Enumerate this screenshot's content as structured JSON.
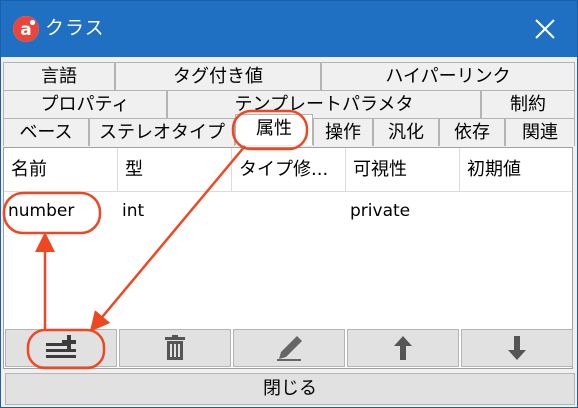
{
  "window": {
    "title": "クラス",
    "app_icon": "astah-logo-icon",
    "close_icon": "close-icon"
  },
  "tabs": {
    "row1": [
      "言語",
      "タグ付き値",
      "ハイパーリンク"
    ],
    "row2": [
      "プロパティ",
      "テンプレートパラメタ",
      "制約"
    ],
    "row3": [
      "ベース",
      "ステレオタイプ",
      "属性",
      "操作",
      "汎化",
      "依存",
      "関連"
    ],
    "active": "属性"
  },
  "table": {
    "columns": [
      "名前",
      "型",
      "タイプ修...",
      "可視性",
      "初期値"
    ],
    "rows": [
      {
        "name": "number",
        "type": "int",
        "modifier": "",
        "visibility": "private",
        "initial": ""
      }
    ]
  },
  "toolbar": {
    "buttons": [
      "add-attribute-icon",
      "delete-icon",
      "edit-pen-icon",
      "move-up-icon",
      "move-down-icon"
    ]
  },
  "footer": {
    "close_label": "閉じる"
  },
  "colors": {
    "titlebar": "#1f6fc2",
    "annotation": "#ee4822",
    "brand": "#e8453c"
  }
}
